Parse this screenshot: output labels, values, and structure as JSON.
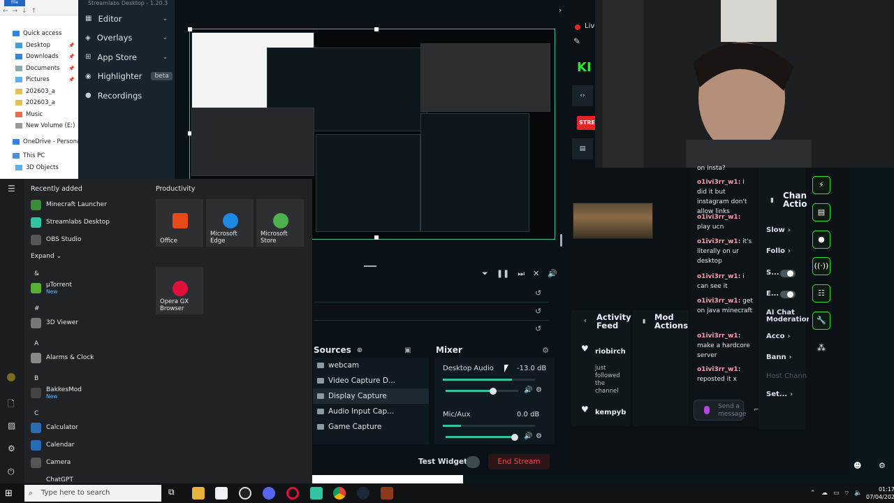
{
  "explorer": {
    "items": [
      {
        "label": "Quick access",
        "color": "#2e86de"
      },
      {
        "label": "Desktop",
        "color": "#3aa0e0",
        "pinned": true
      },
      {
        "label": "Downloads",
        "color": "#2e86de",
        "pinned": true
      },
      {
        "label": "Documents",
        "color": "#8aa",
        "pinned": true
      },
      {
        "label": "Pictures",
        "color": "#5ab0e8",
        "pinned": true
      },
      {
        "label": "202603_a",
        "color": "#e8c050"
      },
      {
        "label": "202603_a",
        "color": "#e8c050"
      },
      {
        "label": "Music",
        "color": "#e07050"
      },
      {
        "label": "New Volume (E:)",
        "color": "#999"
      },
      {
        "label": "OneDrive - Personal",
        "color": "#2e86de"
      },
      {
        "label": "This PC",
        "color": "#4a90d9"
      },
      {
        "label": "3D Objects",
        "color": "#5ab0e8"
      }
    ]
  },
  "streamlabs": {
    "title": "Streamlabs Desktop - 1.20.3",
    "menu": [
      {
        "label": "Editor",
        "chevron": true
      },
      {
        "label": "Overlays",
        "chevron": true
      },
      {
        "label": "App Store",
        "chevron": true
      },
      {
        "label": "Highlighter",
        "badge": "beta"
      },
      {
        "label": "Recordings"
      }
    ],
    "sources_title": "Sources",
    "sources": [
      {
        "label": "webcam",
        "selected": false
      },
      {
        "label": "Video Capture D...",
        "selected": false
      },
      {
        "label": "Display Capture",
        "selected": true
      },
      {
        "label": "Audio Input Cap...",
        "selected": false
      },
      {
        "label": "Game Capture",
        "selected": false
      }
    ],
    "mixer_title": "Mixer",
    "mixer": [
      {
        "name": "Desktop Audio",
        "db": "-13.0 dB",
        "level": 0.75,
        "volume": 0.65
      },
      {
        "name": "Mic/Aux",
        "db": "0.0 dB",
        "level": 0.2,
        "volume": 0.95
      }
    ],
    "test_widgets": "Test Widgets",
    "end_stream": "End Stream",
    "live": "Live"
  },
  "chat": {
    "messages": [
      {
        "user": "",
        "text": "on insta?"
      },
      {
        "user": "o1ivi3rr_w1:",
        "text": "i did it but instagram don't allow links"
      },
      {
        "user": "o1ivi3rr_w1:",
        "text": "play ucn"
      },
      {
        "user": "o1ivi3rr_w1:",
        "text": "it's literally on ur desktop"
      },
      {
        "user": "o1ivi3rr_w1:",
        "text": "i can see it"
      },
      {
        "user": "o1ivi3rr_w1:",
        "text": "get on java minecraft"
      },
      {
        "user": "o1ivi3rr_w1:",
        "text": "make a hardcore server"
      },
      {
        "user": "o1ivi3rr_w1:",
        "text": "reposted it x"
      }
    ],
    "input_placeholder": "Send a message"
  },
  "channel_panel": {
    "title": "Chan Actio",
    "items": [
      {
        "label": "Slow",
        "type": "arrow"
      },
      {
        "label": "Follo",
        "type": "arrow"
      },
      {
        "label": "S...",
        "type": "toggle"
      },
      {
        "label": "E...",
        "type": "toggle"
      },
      {
        "label": "AI Chat Moderation",
        "type": "text"
      },
      {
        "label": "Acco",
        "type": "arrow"
      },
      {
        "label": "Bann",
        "type": "arrow"
      },
      {
        "label": "Host Chann",
        "type": "dim"
      },
      {
        "label": "Set...",
        "type": "arrow"
      }
    ]
  },
  "activity": {
    "title": "Activity Feed",
    "mod_title": "Mod Actions",
    "events": [
      {
        "name": "riobirch",
        "sub": "just followed the channel"
      },
      {
        "name": "kempyb",
        "sub": ""
      }
    ]
  },
  "stream_badge": "STRE",
  "start_menu": {
    "recently_added": "Recently added",
    "productivity": "Productivity",
    "expand": "Expand",
    "apps": [
      {
        "label": "Minecraft Launcher",
        "color": "#3c8a3c"
      },
      {
        "label": "Streamlabs Desktop",
        "color": "#31c3a2"
      },
      {
        "label": "OBS Studio",
        "color": "#555"
      }
    ],
    "groups": [
      {
        "letter": "&",
        "apps": [
          {
            "label": "µTorrent",
            "new": "New",
            "color": "#55b035"
          }
        ]
      },
      {
        "letter": "#",
        "apps": [
          {
            "label": "3D Viewer",
            "new": "",
            "color": "#777"
          }
        ]
      },
      {
        "letter": "A",
        "apps": [
          {
            "label": "Alarms & Clock",
            "new": "",
            "color": "#888"
          }
        ]
      },
      {
        "letter": "B",
        "apps": [
          {
            "label": "BakkesMod",
            "new": "New",
            "color": "#444"
          }
        ]
      },
      {
        "letter": "C",
        "apps": [
          {
            "label": "Calculator",
            "new": "",
            "color": "#2b6cb0"
          },
          {
            "label": "Calendar",
            "new": "",
            "color": "#2b6cb0"
          },
          {
            "label": "Camera",
            "new": "",
            "color": "#555"
          },
          {
            "label": "ChatGPT",
            "new": "",
            "color": "#222"
          }
        ]
      }
    ],
    "tiles": [
      {
        "label": "Office",
        "color": "#e64a19"
      },
      {
        "label": "Microsoft Edge",
        "color": "#1e88e5"
      },
      {
        "label": "Microsoft Store",
        "color": "#4caf50"
      },
      {
        "label": "Opera GX Browser",
        "color": "#e0103a"
      }
    ]
  },
  "taskbar": {
    "search_placeholder": "Type here to search",
    "time": "01:17",
    "date": "07/04/202"
  }
}
